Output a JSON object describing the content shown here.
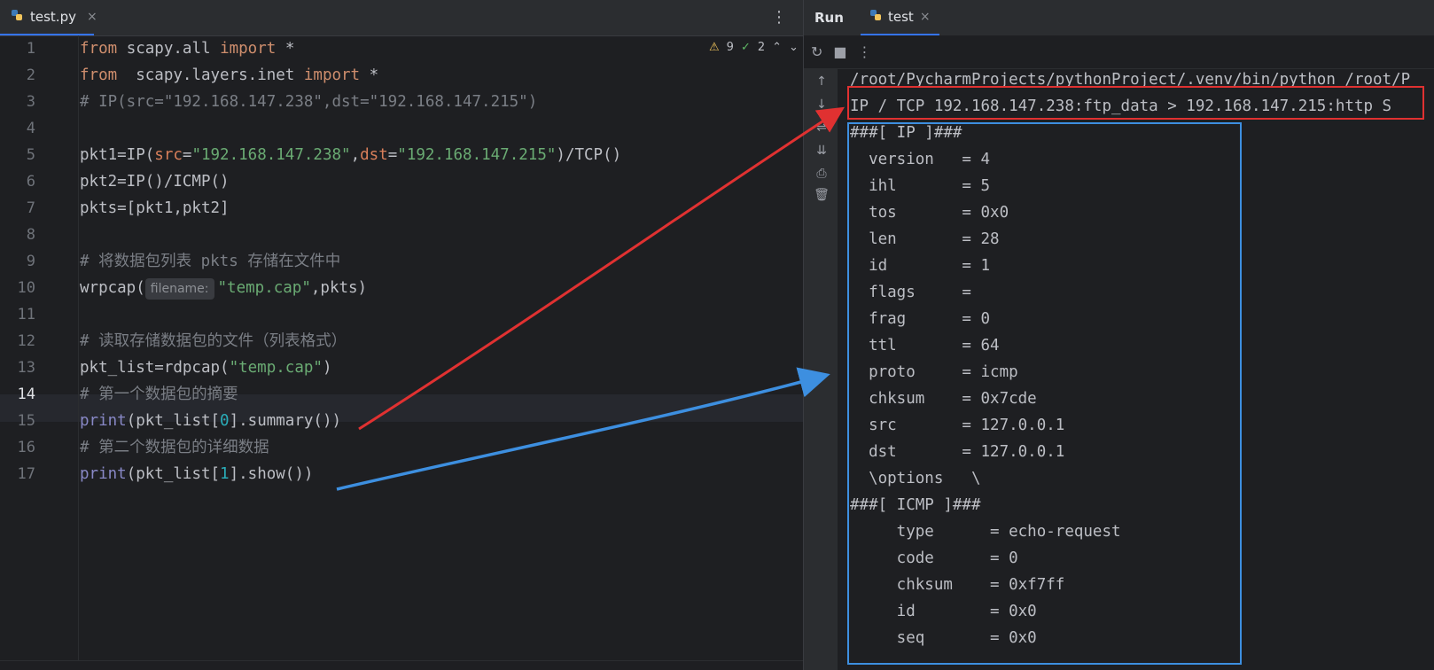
{
  "editor": {
    "tab": {
      "label": "test.py",
      "close": "×"
    },
    "menu_glyph": "⋮",
    "inspections": {
      "warnings": "9",
      "ok": "2"
    },
    "param_hint": "filename:",
    "lines": [
      "1",
      "2",
      "3",
      "4",
      "5",
      "6",
      "7",
      "8",
      "9",
      "10",
      "11",
      "12",
      "13",
      "14",
      "15",
      "16",
      "17"
    ]
  },
  "code": {
    "l1": {
      "kw1": "from",
      "mid": " scapy.all ",
      "kw2": "import",
      "rest": " *"
    },
    "l2": {
      "kw1": "from",
      "mid": "  scapy.layers.inet ",
      "kw2": "import",
      "rest": " *"
    },
    "l3": "# IP(src=\"192.168.147.238\",dst=\"192.168.147.215\")",
    "l5": {
      "a": "pkt1=IP(",
      "p1": "src",
      "eq1": "=",
      "s1": "\"192.168.147.238\"",
      "comma": ",",
      "p2": "dst",
      "eq2": "=",
      "s2": "\"192.168.147.215\"",
      "b": ")/TCP()"
    },
    "l6": "pkt2=IP()/ICMP()",
    "l7": "pkts=[pkt1,pkt2]",
    "l9": "# 将数据包列表 pkts 存储在文件中",
    "l10": {
      "a": "wrpcap(",
      "s": "\"temp.cap\"",
      "b": ",pkts)"
    },
    "l12": "# 读取存储数据包的文件（列表格式）",
    "l13": {
      "a": "pkt_list=rdpcap(",
      "s": "\"temp.cap\"",
      "b": ")"
    },
    "l14": "# 第一个数据包的摘要",
    "l15": {
      "fn": "print",
      "a": "(pkt_list[",
      "n": "0",
      "b": "].summary())"
    },
    "l16": "# 第二个数据包的详细数据",
    "l17": {
      "fn": "print",
      "a": "(pkt_list[",
      "n": "1",
      "b": "].show())"
    }
  },
  "run": {
    "title": "Run",
    "tab": {
      "label": "test",
      "close": "×"
    },
    "toolbar": {
      "rerun": "↻",
      "stop": "■",
      "more": "⋮"
    },
    "side_icons": [
      "↑",
      "↓",
      "⇌",
      "⇊",
      "⎙",
      "🗑"
    ],
    "console": [
      "/root/PycharmProjects/pythonProject/.venv/bin/python /root/P",
      "IP / TCP 192.168.147.238:ftp_data > 192.168.147.215:http S",
      "###[ IP ]###",
      "  version   = 4",
      "  ihl       = 5",
      "  tos       = 0x0",
      "  len       = 28",
      "  id        = 1",
      "  flags     = ",
      "  frag      = 0",
      "  ttl       = 64",
      "  proto     = icmp",
      "  chksum    = 0x7cde",
      "  src       = 127.0.0.1",
      "  dst       = 127.0.0.1",
      "  \\options   \\",
      "###[ ICMP ]###",
      "     type      = echo-request",
      "     code      = 0",
      "     chksum    = 0xf7ff",
      "     id        = 0x0",
      "     seq       = 0x0"
    ]
  },
  "colors": {
    "annotation_red": "#e03131",
    "annotation_blue": "#3d8fe0",
    "accent": "#3574f0"
  }
}
